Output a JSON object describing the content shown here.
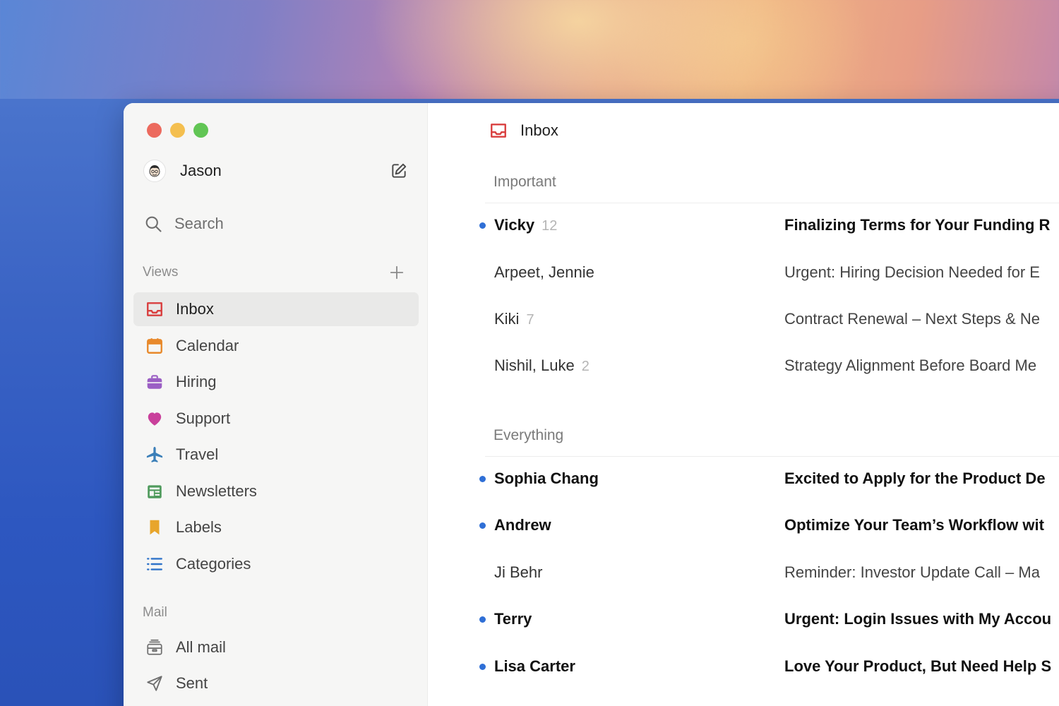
{
  "account": {
    "name": "Jason"
  },
  "search": {
    "label": "Search"
  },
  "views": {
    "title": "Views",
    "items": [
      {
        "label": "Inbox",
        "icon": "inbox-icon",
        "color": "#d93f3f",
        "active": true
      },
      {
        "label": "Calendar",
        "icon": "calendar-icon",
        "color": "#e8892b",
        "active": false
      },
      {
        "label": "Hiring",
        "icon": "briefcase-icon",
        "color": "#9b5fc4",
        "active": false
      },
      {
        "label": "Support",
        "icon": "heart-icon",
        "color": "#c9409b",
        "active": false
      },
      {
        "label": "Travel",
        "icon": "airplane-icon",
        "color": "#3b7fb8",
        "active": false
      },
      {
        "label": "Newsletters",
        "icon": "newspaper-icon",
        "color": "#4f9a5c",
        "active": false
      },
      {
        "label": "Labels",
        "icon": "bookmark-icon",
        "color": "#e8a52b",
        "active": false
      },
      {
        "label": "Categories",
        "icon": "list-icon",
        "color": "#2f73c9",
        "active": false
      }
    ]
  },
  "mail": {
    "title": "Mail",
    "items": [
      {
        "label": "All mail",
        "icon": "archive-icon"
      },
      {
        "label": "Sent",
        "icon": "send-icon"
      }
    ]
  },
  "main": {
    "title": "Inbox",
    "groups": [
      {
        "title": "Important",
        "rows": [
          {
            "sender": "Vicky",
            "count": "12",
            "subject": "Finalizing Terms for Your Funding R",
            "unread": true
          },
          {
            "sender": "Arpeet, Jennie",
            "count": "",
            "subject": "Urgent: Hiring Decision Needed for E",
            "unread": false
          },
          {
            "sender": "Kiki",
            "count": "7",
            "subject": "Contract Renewal – Next Steps & Ne",
            "unread": false
          },
          {
            "sender": "Nishil, Luke",
            "count": "2",
            "subject": "Strategy Alignment Before Board Me",
            "unread": false
          }
        ]
      },
      {
        "title": "Everything",
        "rows": [
          {
            "sender": "Sophia Chang",
            "count": "",
            "subject": "Excited to Apply for the Product De",
            "unread": true
          },
          {
            "sender": "Andrew",
            "count": "",
            "subject": "Optimize Your Team’s Workflow wit",
            "unread": true
          },
          {
            "sender": "Ji Behr",
            "count": "",
            "subject": "Reminder: Investor Update Call – Ma",
            "unread": false
          },
          {
            "sender": "Terry",
            "count": "",
            "subject": "Urgent: Login Issues with My Accou",
            "unread": true
          },
          {
            "sender": "Lisa Carter",
            "count": "",
            "subject": "Love Your Product, But Need Help S",
            "unread": true
          }
        ]
      }
    ]
  },
  "colors": {
    "unread_dot": "#2f6fd6",
    "inbox_red": "#d93f3f"
  }
}
